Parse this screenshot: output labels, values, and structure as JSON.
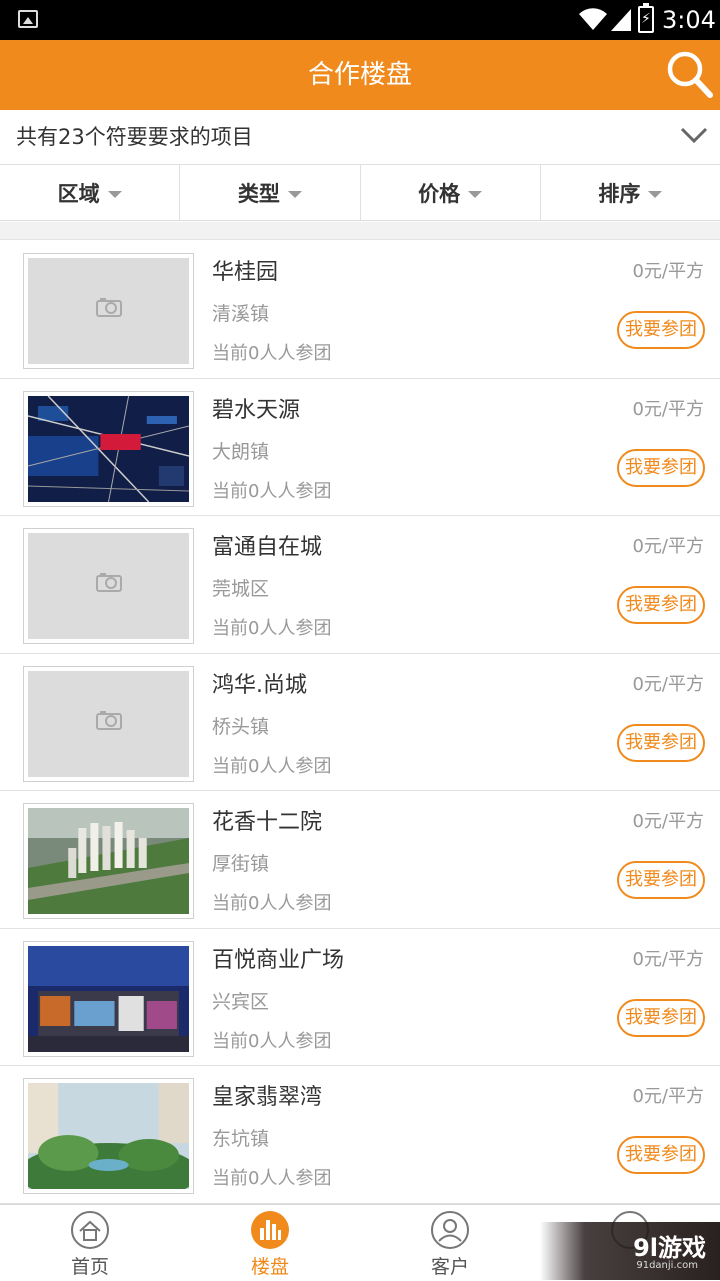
{
  "status_bar": {
    "time": "3:04"
  },
  "header": {
    "title": "合作楼盘"
  },
  "result": {
    "text": "共有23个符要要求的项目"
  },
  "filters": [
    {
      "label": "区域"
    },
    {
      "label": "类型"
    },
    {
      "label": "价格"
    },
    {
      "label": "排序"
    }
  ],
  "listings": [
    {
      "name": "华桂园",
      "town": "清溪镇",
      "participants": "当前0人人参团",
      "price": "0元/平方",
      "button": "我要参团",
      "image": "placeholder"
    },
    {
      "name": "碧水天源",
      "town": "大朗镇",
      "participants": "当前0人人参团",
      "price": "0元/平方",
      "button": "我要参团",
      "image": "map"
    },
    {
      "name": "富通自在城",
      "town": "莞城区",
      "participants": "当前0人人参团",
      "price": "0元/平方",
      "button": "我要参团",
      "image": "placeholder"
    },
    {
      "name": "鸿华.尚城",
      "town": "桥头镇",
      "participants": "当前0人人参团",
      "price": "0元/平方",
      "button": "我要参团",
      "image": "placeholder"
    },
    {
      "name": "花香十二院",
      "town": "厚街镇",
      "participants": "当前0人人参团",
      "price": "0元/平方",
      "button": "我要参团",
      "image": "aerial"
    },
    {
      "name": "百悦商业广场",
      "town": "兴宾区",
      "participants": "当前0人人参团",
      "price": "0元/平方",
      "button": "我要参团",
      "image": "night"
    },
    {
      "name": "皇家翡翠湾",
      "town": "东坑镇",
      "participants": "当前0人人参团",
      "price": "0元/平方",
      "button": "我要参团",
      "image": "garden"
    }
  ],
  "tabs": [
    {
      "label": "首页",
      "icon": "home-icon",
      "active": false
    },
    {
      "label": "楼盘",
      "icon": "chart-icon",
      "active": true
    },
    {
      "label": "客户",
      "icon": "user-icon",
      "active": false
    },
    {
      "label": "",
      "icon": "profile-icon",
      "active": false
    }
  ],
  "watermark": {
    "text": "9l游戏",
    "sub": "91danji.com"
  },
  "colors": {
    "accent": "#f08a1c",
    "text": "#333333",
    "muted": "#999999"
  }
}
